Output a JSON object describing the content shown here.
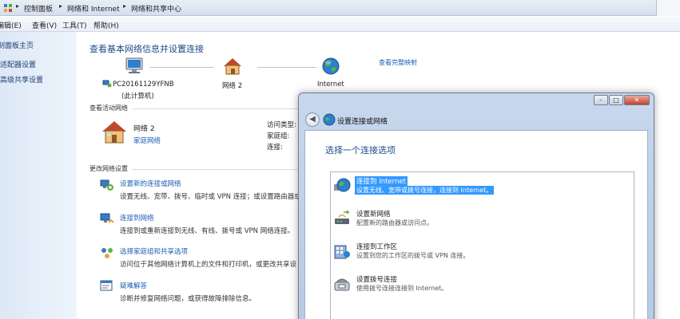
{
  "breadcrumb": [
    "控制面板",
    "网络和 Internet",
    "网络和共享中心"
  ],
  "menu": [
    "编辑(E)",
    "查看(V)",
    "工具(T)",
    "帮助(H)"
  ],
  "sidebar": {
    "items": [
      "控制面板主页",
      "更改适配器设置",
      "更改高级共享设置"
    ]
  },
  "main": {
    "title": "查看基本网络信息并设置连接",
    "see_full_map": "查看完整映射",
    "nodes": [
      {
        "label": "PC20161129YFNB",
        "sub": "(此计算机)",
        "icon": "computer-icon"
      },
      {
        "label": "网络  2",
        "icon": "home-network-icon"
      },
      {
        "label": "Internet",
        "icon": "globe-icon"
      }
    ],
    "active_section": "查看活动网络",
    "network": {
      "name": "网络  2",
      "type": "家庭网络"
    },
    "props": {
      "access_type": "访问类型:",
      "homegroup": "家庭组:",
      "connection": "连接:"
    },
    "change_section": "更改网络设置",
    "tasks": [
      {
        "title": "设置新的连接或网络",
        "desc": "设置无线、宽带、拨号、临时或 VPN 连接；或设置路由器或",
        "icon": "new-connection-icon"
      },
      {
        "title": "连接到网络",
        "desc": "连接到或重新连接到无线、有线、拨号或 VPN 网络连接。",
        "icon": "connect-network-icon"
      },
      {
        "title": "选择家庭组和共享选项",
        "desc": "访问位于其他网络计算机上的文件和打印机，或更改共享设",
        "icon": "homegroup-icon"
      },
      {
        "title": "疑难解答",
        "desc": "诊断并修复网络问题，或获得故障排除信息。",
        "icon": "troubleshoot-icon"
      }
    ]
  },
  "dialog": {
    "title": "设置连接或网络",
    "heading": "选择一个连接选项",
    "options": [
      {
        "title": "连接到 Internet",
        "desc": "设置无线、宽带或拨号连接，连接到 Internet。",
        "icon": "globe-connect-icon",
        "selected": true
      },
      {
        "title": "设置新网络",
        "desc": "配置新的路由器或访问点。",
        "icon": "router-icon",
        "selected": false
      },
      {
        "title": "连接到工作区",
        "desc": "设置到您的工作区的拨号或 VPN 连接。",
        "icon": "workplace-icon",
        "selected": false
      },
      {
        "title": "设置拨号连接",
        "desc": "使用拨号连接连接到 Internet。",
        "icon": "dialup-icon",
        "selected": false
      }
    ]
  },
  "colors": {
    "link": "#1d5fb5",
    "heading": "#1e4a8a",
    "selection": "#3399ff"
  }
}
